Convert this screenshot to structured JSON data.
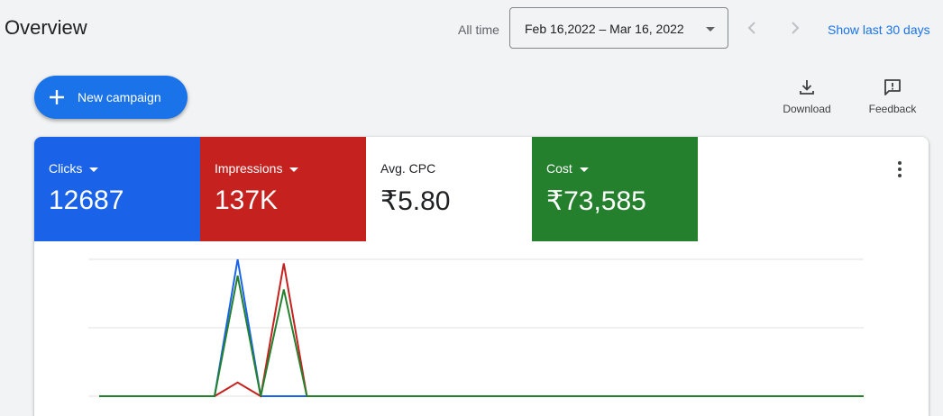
{
  "header": {
    "title": "Overview",
    "range_label": "All time",
    "date_range": "Feb 16,2022 – Mar 16, 2022",
    "show_last": "Show last 30 days"
  },
  "toolbar": {
    "new_campaign": "New campaign",
    "download": "Download",
    "feedback": "Feedback"
  },
  "metrics": [
    {
      "label": "Clicks",
      "value": "12687",
      "color": "#1a63e8"
    },
    {
      "label": "Impressions",
      "value": "137K",
      "color": "#c5221f"
    },
    {
      "label": "Avg. CPC",
      "value": "₹5.80",
      "color": "#ffffff"
    },
    {
      "label": "Cost",
      "value": "₹73,585",
      "color": "#25802e"
    }
  ],
  "icons": [
    "chevron-left-icon",
    "chevron-right-icon",
    "dropdown-arrow-icon",
    "plus-icon",
    "download-icon",
    "feedback-icon",
    "more-vert-icon"
  ],
  "chart_data": {
    "type": "line",
    "x": [
      0,
      1,
      2,
      3,
      4,
      5,
      6,
      7,
      8,
      9,
      10,
      11,
      12,
      13,
      14,
      15,
      16,
      17,
      18,
      19,
      20,
      21,
      22,
      23,
      24,
      25,
      26,
      27,
      28,
      29,
      30,
      31,
      32,
      33
    ],
    "series": [
      {
        "color": "#1a63e8",
        "values": [
          0,
          0,
          0,
          0,
          0,
          0,
          1.0,
          0,
          0,
          0,
          0,
          0,
          0,
          0,
          0,
          0,
          0,
          0,
          0,
          0,
          0,
          0,
          0,
          0,
          0,
          0,
          0,
          0,
          0,
          0,
          0,
          0,
          0,
          0
        ]
      },
      {
        "color": "#c5221f",
        "values": [
          0,
          0,
          0,
          0,
          0,
          0,
          0.1,
          0,
          0.97,
          0,
          0,
          0,
          0,
          0,
          0,
          0,
          0,
          0,
          0,
          0,
          0,
          0,
          0,
          0,
          0,
          0,
          0,
          0,
          0,
          0,
          0,
          0,
          0,
          0
        ]
      },
      {
        "color": "#25802e",
        "values": [
          0,
          0,
          0,
          0,
          0,
          0,
          0.88,
          0,
          0.78,
          0,
          0,
          0,
          0,
          0,
          0,
          0,
          0,
          0,
          0,
          0,
          0,
          0,
          0,
          0,
          0,
          0,
          0,
          0,
          0,
          0,
          0,
          0,
          0,
          0
        ]
      }
    ],
    "gridlines": 3,
    "ylim": [
      0,
      1.0
    ],
    "grid": true
  }
}
